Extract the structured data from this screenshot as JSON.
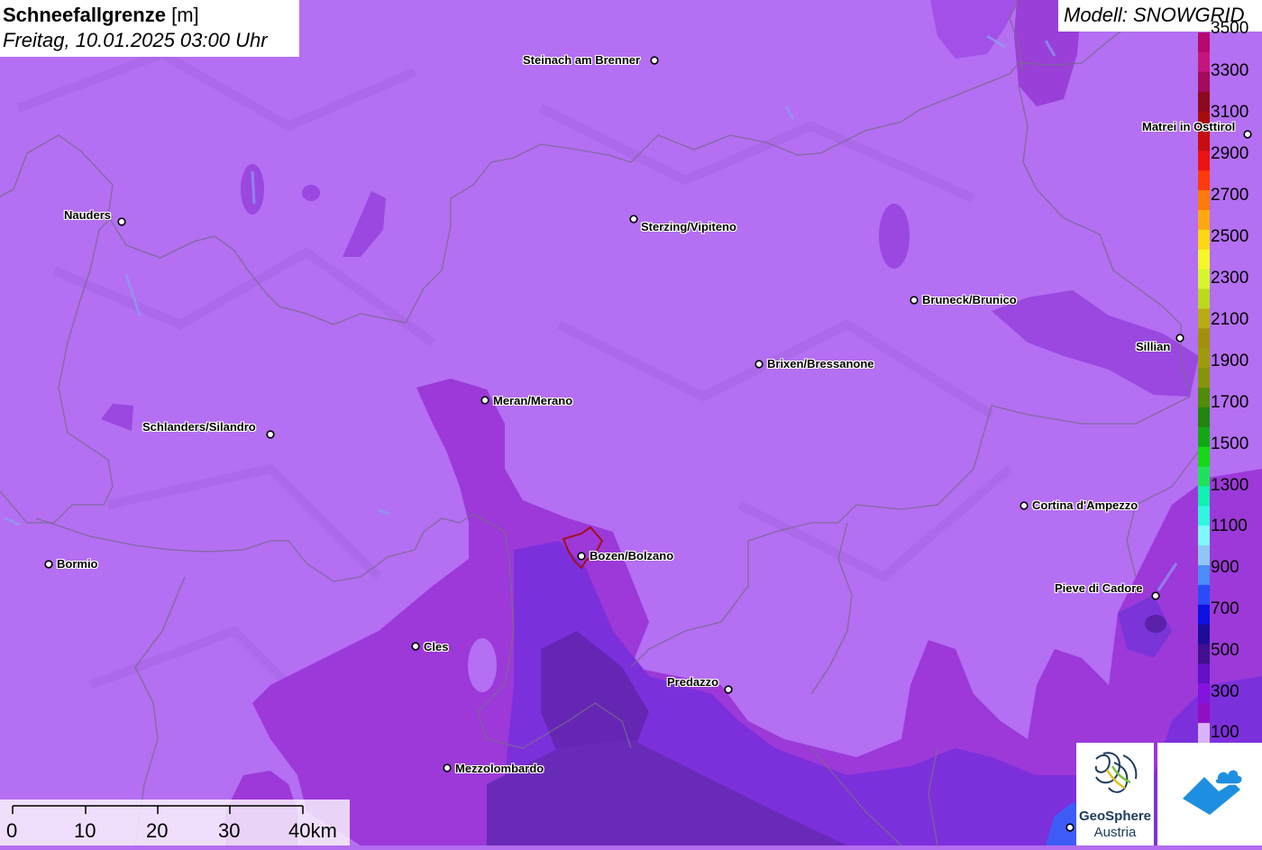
{
  "title": {
    "bold": "Schneefallgrenze",
    "unit": "[m]",
    "datetime": "Freitag, 10.01.2025 03:00 Uhr"
  },
  "model_label": "Modell: SNOWGRID",
  "cities": [
    {
      "name": "Steinach am Brenner"
    },
    {
      "name": "Nauders"
    },
    {
      "name": "Sterzing/Vipiteno"
    },
    {
      "name": "Matrei in Osttirol"
    },
    {
      "name": "Bruneck/Brunico"
    },
    {
      "name": "Sillian"
    },
    {
      "name": "Brixen/Bressanone"
    },
    {
      "name": "Meran/Merano"
    },
    {
      "name": "Schlanders/Silandro"
    },
    {
      "name": "Cortina d'Ampezzo"
    },
    {
      "name": "Bormio"
    },
    {
      "name": "Bozen/Bolzano"
    },
    {
      "name": "Pieve di Cadore"
    },
    {
      "name": "Cles"
    },
    {
      "name": "Predazzo"
    },
    {
      "name": "Mezzolombardo"
    }
  ],
  "legend": {
    "labels": [
      "3500",
      "3300",
      "3100",
      "2900",
      "2700",
      "2500",
      "2300",
      "2100",
      "1900",
      "1700",
      "1500",
      "1300",
      "1100",
      "900",
      "700",
      "500",
      "300",
      "100"
    ],
    "colors": [
      "#b7086e",
      "#c4167c",
      "#a60a5c",
      "#8c0a1e",
      "#a50d0d",
      "#c70d0d",
      "#ec1313",
      "#fd3a0c",
      "#fd7a0c",
      "#fca812",
      "#fcd615",
      "#f4f72a",
      "#d6f52c",
      "#bcd91c",
      "#b8ac14",
      "#a0900c",
      "#9e9a0a",
      "#86940a",
      "#508c08",
      "#20860e",
      "#12a814",
      "#16d816",
      "#1ee25a",
      "#10f0b4",
      "#32f6e0",
      "#7ef8fc",
      "#8ec6f8",
      "#4a8cfa",
      "#2a4cf8",
      "#0c12e0",
      "#1c0c9a",
      "#40108e",
      "#6410c8",
      "#8612e0",
      "#9010c4",
      "#d8b4f8"
    ]
  },
  "scale": {
    "labels": [
      "0",
      "10",
      "20",
      "30",
      "40km"
    ]
  },
  "logos": {
    "geosphere_line1": "GeoSphere",
    "geosphere_line2": "Austria"
  }
}
